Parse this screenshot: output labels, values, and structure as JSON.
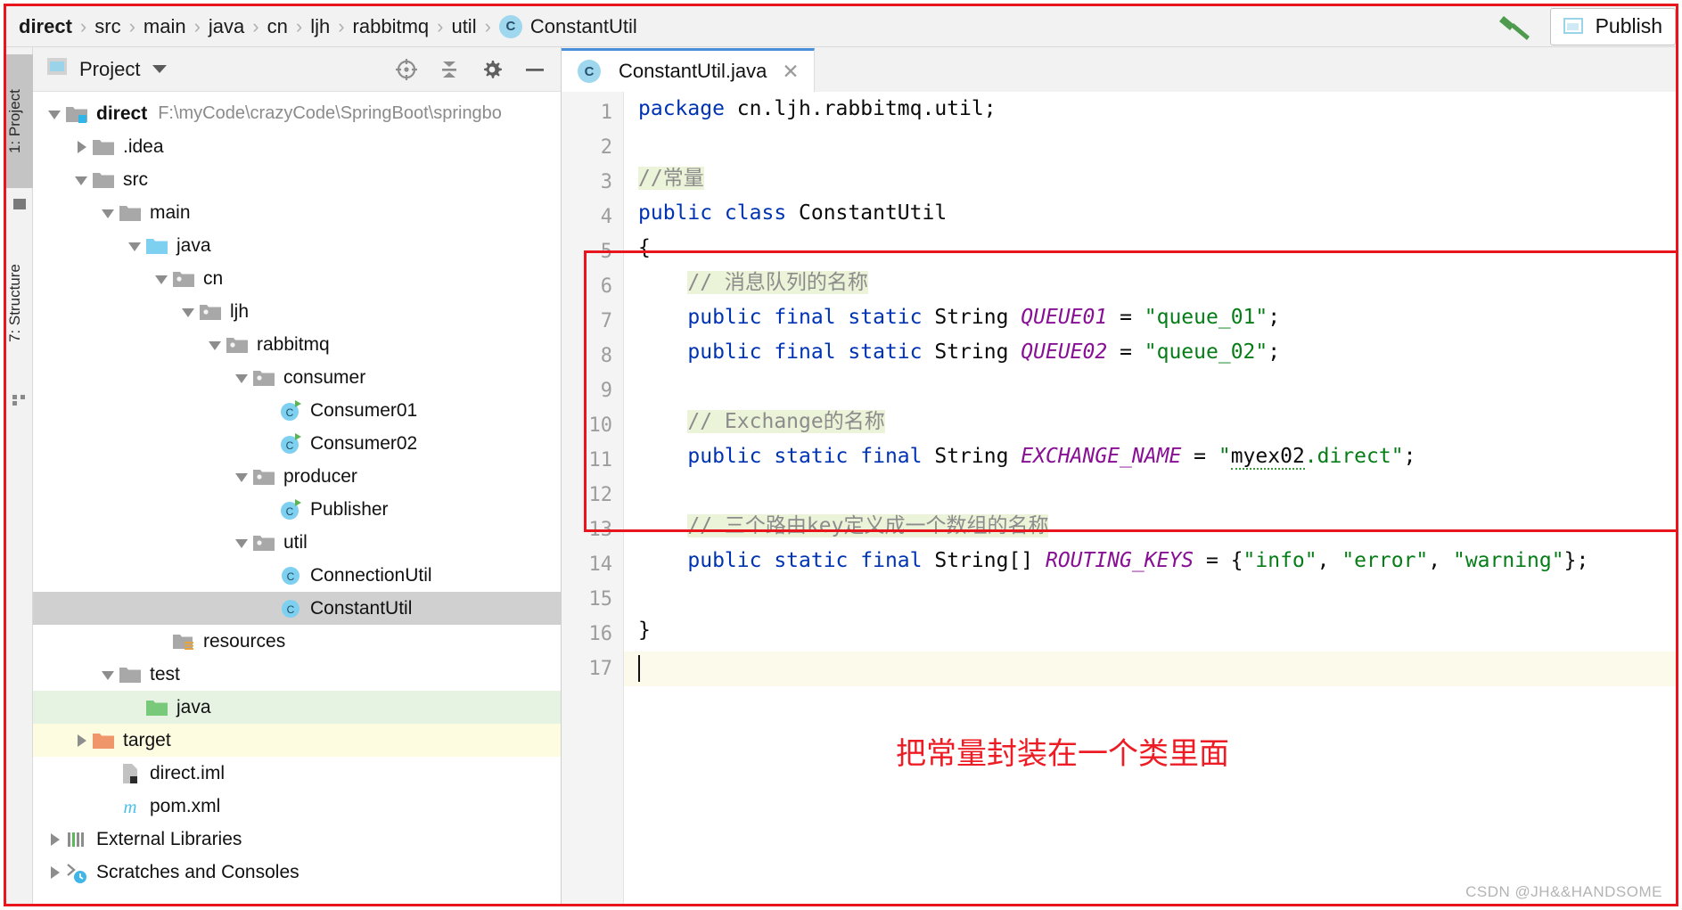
{
  "breadcrumb": {
    "separator": "›",
    "items": [
      "direct",
      "src",
      "main",
      "java",
      "cn",
      "ljh",
      "rabbitmq",
      "util"
    ],
    "class_chip": "C",
    "class_name": "ConstantUtil"
  },
  "top_right": {
    "hammer_icon": "hammer-icon",
    "publish_label": "Publish",
    "publish_icon": "publish-window-icon"
  },
  "left_strip": {
    "tabs": [
      {
        "label": "1: Project",
        "active": true,
        "icon": "project-icon"
      },
      {
        "label": "7: Structure",
        "active": false,
        "icon": "structure-icon"
      }
    ]
  },
  "project_panel": {
    "title": "Project",
    "title_icon": "project-window-icon",
    "dropdown_icon": "chevron-down-icon",
    "tools": [
      "locate-crosshair-icon",
      "collapse-all-icon",
      "settings-gear-icon",
      "hide-minimize-icon"
    ],
    "tree": [
      {
        "label": "direct",
        "detail": "F:\\myCode\\crazyCode\\SpringBoot\\springbo",
        "depth": 0,
        "arrow": "open",
        "icon": "module-folder-icon",
        "bold": true,
        "state": "normal"
      },
      {
        "label": ".idea",
        "detail": "",
        "depth": 1,
        "arrow": "closed",
        "icon": "folder-icon",
        "bold": false,
        "state": "normal"
      },
      {
        "label": "src",
        "detail": "",
        "depth": 1,
        "arrow": "open",
        "icon": "folder-icon",
        "bold": false,
        "state": "normal"
      },
      {
        "label": "main",
        "detail": "",
        "depth": 2,
        "arrow": "open",
        "icon": "folder-icon",
        "bold": false,
        "state": "normal"
      },
      {
        "label": "java",
        "detail": "",
        "depth": 3,
        "arrow": "open",
        "icon": "source-root-icon",
        "bold": false,
        "state": "normal"
      },
      {
        "label": "cn",
        "detail": "",
        "depth": 4,
        "arrow": "open",
        "icon": "package-icon",
        "bold": false,
        "state": "normal"
      },
      {
        "label": "ljh",
        "detail": "",
        "depth": 5,
        "arrow": "open",
        "icon": "package-icon",
        "bold": false,
        "state": "normal"
      },
      {
        "label": "rabbitmq",
        "detail": "",
        "depth": 6,
        "arrow": "open",
        "icon": "package-icon",
        "bold": false,
        "state": "normal"
      },
      {
        "label": "consumer",
        "detail": "",
        "depth": 7,
        "arrow": "open",
        "icon": "package-icon",
        "bold": false,
        "state": "normal"
      },
      {
        "label": "Consumer01",
        "detail": "",
        "depth": 8,
        "arrow": "none",
        "icon": "runnable-class-icon",
        "bold": false,
        "state": "normal"
      },
      {
        "label": "Consumer02",
        "detail": "",
        "depth": 8,
        "arrow": "none",
        "icon": "runnable-class-icon",
        "bold": false,
        "state": "normal"
      },
      {
        "label": "producer",
        "detail": "",
        "depth": 7,
        "arrow": "open",
        "icon": "package-icon",
        "bold": false,
        "state": "normal"
      },
      {
        "label": "Publisher",
        "detail": "",
        "depth": 8,
        "arrow": "none",
        "icon": "runnable-class-icon",
        "bold": false,
        "state": "normal"
      },
      {
        "label": "util",
        "detail": "",
        "depth": 7,
        "arrow": "open",
        "icon": "package-icon",
        "bold": false,
        "state": "normal"
      },
      {
        "label": "ConnectionUtil",
        "detail": "",
        "depth": 8,
        "arrow": "none",
        "icon": "class-icon",
        "bold": false,
        "state": "normal"
      },
      {
        "label": "ConstantUtil",
        "detail": "",
        "depth": 8,
        "arrow": "none",
        "icon": "class-icon",
        "bold": false,
        "state": "selected"
      },
      {
        "label": "resources",
        "detail": "",
        "depth": 4,
        "arrow": "none",
        "icon": "resources-root-icon",
        "bold": false,
        "state": "normal"
      },
      {
        "label": "test",
        "detail": "",
        "depth": 2,
        "arrow": "open",
        "icon": "folder-icon",
        "bold": false,
        "state": "normal"
      },
      {
        "label": "java",
        "detail": "",
        "depth": 3,
        "arrow": "none",
        "icon": "test-source-root-icon",
        "bold": false,
        "state": "green"
      },
      {
        "label": "target",
        "detail": "",
        "depth": 1,
        "arrow": "closed",
        "icon": "excluded-folder-icon",
        "bold": false,
        "state": "yellow"
      },
      {
        "label": "direct.iml",
        "detail": "",
        "depth": 2,
        "arrow": "none",
        "icon": "iml-file-icon",
        "bold": false,
        "state": "normal"
      },
      {
        "label": "pom.xml",
        "detail": "",
        "depth": 2,
        "arrow": "none",
        "icon": "maven-pom-icon",
        "bold": false,
        "state": "normal"
      },
      {
        "label": "External Libraries",
        "detail": "",
        "depth": 0,
        "arrow": "closed",
        "icon": "libraries-icon",
        "bold": false,
        "state": "normal"
      },
      {
        "label": "Scratches and Consoles",
        "detail": "",
        "depth": 0,
        "arrow": "closed",
        "icon": "scratches-icon",
        "bold": false,
        "state": "normal"
      }
    ]
  },
  "editor": {
    "tab": {
      "label": "ConstantUtil.java",
      "chip": "C",
      "close_icon": "close-icon"
    },
    "line_numbers": [
      "1",
      "2",
      "3",
      "4",
      "5",
      "6",
      "7",
      "8",
      "9",
      "10",
      "11",
      "12",
      "13",
      "14",
      "15",
      "16",
      "17"
    ],
    "current_line": 17,
    "lines": [
      {
        "n": 1,
        "tokens": [
          {
            "t": "package ",
            "c": "kw"
          },
          {
            "t": "cn.ljh.rabbitmq.util;",
            "c": ""
          }
        ]
      },
      {
        "n": 2,
        "tokens": []
      },
      {
        "n": 3,
        "tokens": [
          {
            "t": "//常量",
            "c": "cmt"
          }
        ]
      },
      {
        "n": 4,
        "tokens": [
          {
            "t": "public class ",
            "c": "kw"
          },
          {
            "t": "ConstantUtil",
            "c": ""
          }
        ]
      },
      {
        "n": 5,
        "tokens": [
          {
            "t": "{",
            "c": ""
          }
        ]
      },
      {
        "n": 6,
        "tokens": [
          {
            "t": "    ",
            "c": ""
          },
          {
            "t": "// 消息队列的名称",
            "c": "cmt"
          }
        ]
      },
      {
        "n": 7,
        "tokens": [
          {
            "t": "    ",
            "c": ""
          },
          {
            "t": "public final static ",
            "c": "kw"
          },
          {
            "t": "String ",
            "c": ""
          },
          {
            "t": "QUEUE01",
            "c": "fld"
          },
          {
            "t": " = ",
            "c": ""
          },
          {
            "t": "\"queue_01\"",
            "c": "str"
          },
          {
            "t": ";",
            "c": ""
          }
        ]
      },
      {
        "n": 8,
        "tokens": [
          {
            "t": "    ",
            "c": ""
          },
          {
            "t": "public final static ",
            "c": "kw"
          },
          {
            "t": "String ",
            "c": ""
          },
          {
            "t": "QUEUE02",
            "c": "fld"
          },
          {
            "t": " = ",
            "c": ""
          },
          {
            "t": "\"queue_02\"",
            "c": "str"
          },
          {
            "t": ";",
            "c": ""
          }
        ]
      },
      {
        "n": 9,
        "tokens": []
      },
      {
        "n": 10,
        "tokens": [
          {
            "t": "    ",
            "c": ""
          },
          {
            "t": "// Exchange的名称",
            "c": "cmt"
          }
        ]
      },
      {
        "n": 11,
        "tokens": [
          {
            "t": "    ",
            "c": ""
          },
          {
            "t": "public static final ",
            "c": "kw"
          },
          {
            "t": "String ",
            "c": ""
          },
          {
            "t": "EXCHANGE_NAME",
            "c": "fld"
          },
          {
            "t": " = ",
            "c": ""
          },
          {
            "t": "\"",
            "c": "str"
          },
          {
            "t": "myex02",
            "c": "typo"
          },
          {
            "t": ".direct\"",
            "c": "str"
          },
          {
            "t": ";",
            "c": ""
          }
        ]
      },
      {
        "n": 12,
        "tokens": []
      },
      {
        "n": 13,
        "tokens": [
          {
            "t": "    ",
            "c": ""
          },
          {
            "t": "// 三个路由key定义成一个数组的名称",
            "c": "cmt"
          }
        ]
      },
      {
        "n": 14,
        "tokens": [
          {
            "t": "    ",
            "c": ""
          },
          {
            "t": "public static final ",
            "c": "kw"
          },
          {
            "t": "String[] ",
            "c": ""
          },
          {
            "t": "ROUTING_KEYS",
            "c": "fld"
          },
          {
            "t": " = {",
            "c": ""
          },
          {
            "t": "\"info\"",
            "c": "str"
          },
          {
            "t": ", ",
            "c": ""
          },
          {
            "t": "\"error\"",
            "c": "str"
          },
          {
            "t": ", ",
            "c": ""
          },
          {
            "t": "\"warning\"",
            "c": "str"
          },
          {
            "t": "};",
            "c": ""
          }
        ]
      },
      {
        "n": 15,
        "tokens": []
      },
      {
        "n": 16,
        "tokens": [
          {
            "t": "}",
            "c": ""
          }
        ]
      },
      {
        "n": 17,
        "tokens": []
      }
    ]
  },
  "annotation": {
    "text": "把常量封装在一个类里面",
    "color": "#ed1c24"
  },
  "watermark": {
    "text": "CSDN @JH&&HANDSOME"
  },
  "colors": {
    "keyword": "#0033b3",
    "string": "#067d17",
    "comment_text": "#8c8c8c",
    "comment_bg": "#ebf3d8",
    "field": "#871094",
    "annotation_red": "#e8151d",
    "selection_gray": "#d0d0d0",
    "accent_blue": "#4a90d9"
  }
}
